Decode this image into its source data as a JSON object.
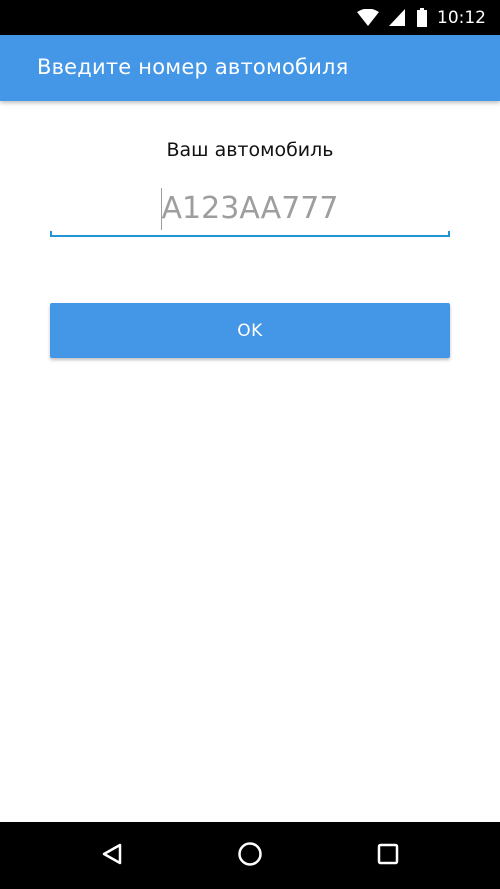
{
  "status_bar": {
    "time": "10:12",
    "icons": [
      "wifi-icon",
      "signal-icon",
      "battery-icon"
    ]
  },
  "app_bar": {
    "title": "Введите номер автомобиля",
    "color": "#4496e6"
  },
  "form": {
    "label": "Ваш автомобиль",
    "plate_input": {
      "value": "",
      "placeholder": "A123AA777"
    },
    "ok_label": "OK"
  },
  "nav_bar": {
    "icons": [
      "back-icon",
      "home-icon",
      "recents-icon"
    ]
  },
  "colors": {
    "accent": "#4496e6",
    "underline": "#2196d6"
  }
}
